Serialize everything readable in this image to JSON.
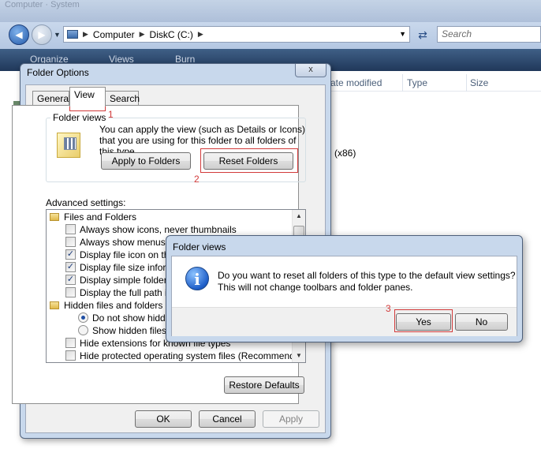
{
  "explorer": {
    "title": "Computer · System",
    "breadcrumb": [
      "Computer",
      "DiskC (C:)"
    ],
    "search_placeholder": "Search",
    "toolbar": [
      "Organize",
      "Views",
      "Burn"
    ],
    "columns": [
      "ate modified",
      "Type",
      "Size"
    ],
    "partial_item": "(x86)"
  },
  "folder_options": {
    "title": "Folder Options",
    "close_label": "x",
    "tabs": [
      "General",
      "View",
      "Search"
    ],
    "folder_views_label": "Folder views",
    "folder_views_text": "You can apply the view (such as Details or Icons) that you are using for this folder to all folders of this type.",
    "apply_to_folders": "Apply to Folders",
    "reset_folders": "Reset Folders",
    "advanced_label": "Advanced settings:",
    "advanced_items": [
      {
        "type": "folder",
        "label": "Files and Folders"
      },
      {
        "type": "check",
        "checked": false,
        "label": "Always show icons, never thumbnails"
      },
      {
        "type": "check",
        "checked": false,
        "label": "Always show menus"
      },
      {
        "type": "check",
        "checked": true,
        "label": "Display file icon on thum"
      },
      {
        "type": "check",
        "checked": true,
        "label": "Display file size informat"
      },
      {
        "type": "check",
        "checked": true,
        "label": "Display simple folder vie"
      },
      {
        "type": "check",
        "checked": false,
        "label": "Display the full path in th"
      },
      {
        "type": "folder",
        "label": "Hidden files and folders"
      },
      {
        "type": "radio",
        "checked": true,
        "label": "Do not show hidden"
      },
      {
        "type": "radio",
        "checked": false,
        "label": "Show hidden files a"
      },
      {
        "type": "check",
        "checked": false,
        "label": "Hide extensions for known file types"
      },
      {
        "type": "check",
        "checked": false,
        "label": "Hide protected operating system files (Recommended)"
      }
    ],
    "restore_defaults": "Restore Defaults",
    "ok": "OK",
    "cancel": "Cancel",
    "apply": "Apply"
  },
  "confirm_dialog": {
    "title": "Folder views",
    "message_line1": "Do you want to reset all folders of this type to the default view settings?",
    "message_line2": "This will not change toolbars and folder panes.",
    "yes": "Yes",
    "no": "No"
  },
  "annotations": [
    "1",
    "2",
    "3"
  ],
  "colors": {
    "annotation_red": "#d23a3a",
    "dialog_frame": "#c8d8ec",
    "toolbar_dark": "#20385a"
  }
}
